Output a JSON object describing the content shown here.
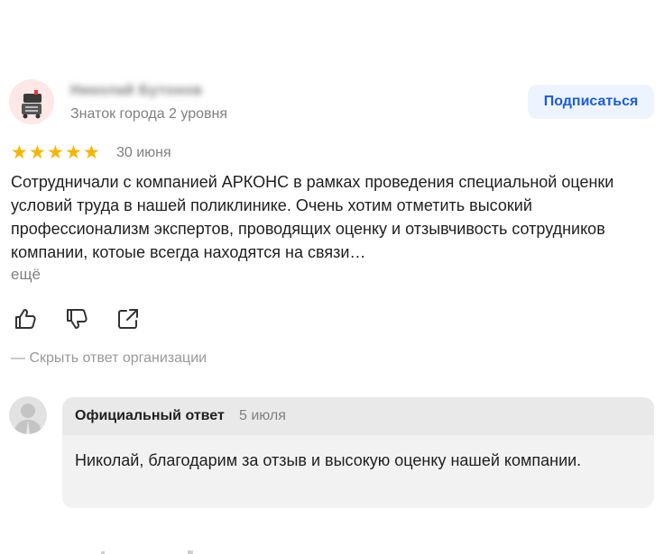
{
  "review": {
    "author": {
      "name": "Николай Бутонов",
      "level": "Знаток города 2 уровня",
      "avatar_icon": "robot-icon"
    },
    "subscribe_label": "Подписаться",
    "rating": 5,
    "stars": [
      "★",
      "★",
      "★",
      "★",
      "★"
    ],
    "date": "30 июня",
    "text": "Сотрудничали с компанией АРКОНС в рамках проведения специальной оценки условий труда в нашей поликлинике. Очень хотим отметить высокий профессионализм экспертов, проводящих оценку и отзывчивость сотрудников компании, котоые всегда находятся на связи…",
    "more_label": "ещё",
    "actions": {
      "like_icon": "thumbs-up-icon",
      "dislike_icon": "thumbs-down-icon",
      "share_icon": "share-icon"
    },
    "hide_answer_label": "— Скрыть ответ организации"
  },
  "org_answer": {
    "title": "Официальный ответ",
    "date": "5 июля",
    "text": "Николай, благодарим за отзыв и высокую оценку нашей компании."
  },
  "colors": {
    "star": "#f7b500",
    "link_blue": "#1a5edb",
    "button_bg": "#eef4ff",
    "muted_text": "#808080",
    "answer_bg": "#f2f2f2"
  }
}
